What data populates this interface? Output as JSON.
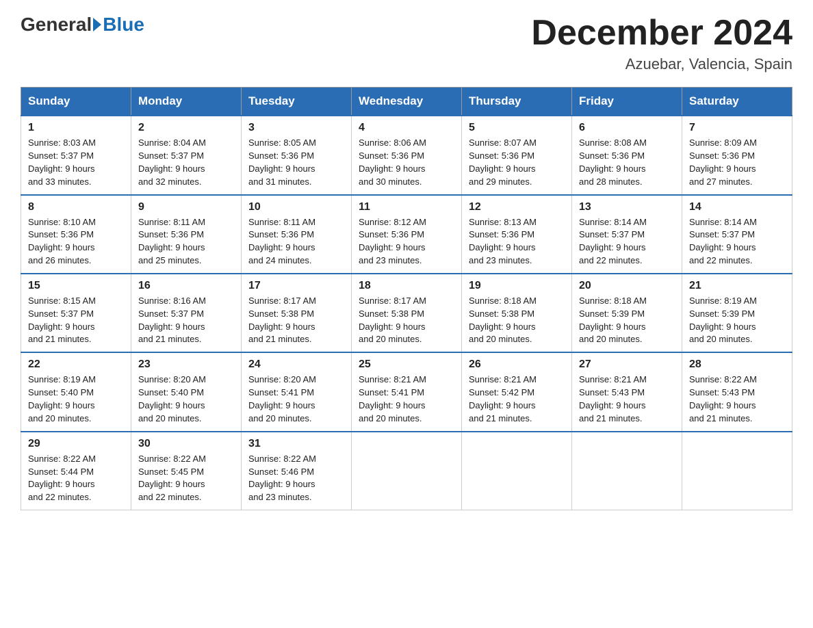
{
  "header": {
    "logo": {
      "general": "General",
      "blue": "Blue"
    },
    "title": "December 2024",
    "location": "Azuebar, Valencia, Spain"
  },
  "days_of_week": [
    "Sunday",
    "Monday",
    "Tuesday",
    "Wednesday",
    "Thursday",
    "Friday",
    "Saturday"
  ],
  "weeks": [
    [
      {
        "day": "1",
        "sunrise": "8:03 AM",
        "sunset": "5:37 PM",
        "daylight": "9 hours and 33 minutes."
      },
      {
        "day": "2",
        "sunrise": "8:04 AM",
        "sunset": "5:37 PM",
        "daylight": "9 hours and 32 minutes."
      },
      {
        "day": "3",
        "sunrise": "8:05 AM",
        "sunset": "5:36 PM",
        "daylight": "9 hours and 31 minutes."
      },
      {
        "day": "4",
        "sunrise": "8:06 AM",
        "sunset": "5:36 PM",
        "daylight": "9 hours and 30 minutes."
      },
      {
        "day": "5",
        "sunrise": "8:07 AM",
        "sunset": "5:36 PM",
        "daylight": "9 hours and 29 minutes."
      },
      {
        "day": "6",
        "sunrise": "8:08 AM",
        "sunset": "5:36 PM",
        "daylight": "9 hours and 28 minutes."
      },
      {
        "day": "7",
        "sunrise": "8:09 AM",
        "sunset": "5:36 PM",
        "daylight": "9 hours and 27 minutes."
      }
    ],
    [
      {
        "day": "8",
        "sunrise": "8:10 AM",
        "sunset": "5:36 PM",
        "daylight": "9 hours and 26 minutes."
      },
      {
        "day": "9",
        "sunrise": "8:11 AM",
        "sunset": "5:36 PM",
        "daylight": "9 hours and 25 minutes."
      },
      {
        "day": "10",
        "sunrise": "8:11 AM",
        "sunset": "5:36 PM",
        "daylight": "9 hours and 24 minutes."
      },
      {
        "day": "11",
        "sunrise": "8:12 AM",
        "sunset": "5:36 PM",
        "daylight": "9 hours and 23 minutes."
      },
      {
        "day": "12",
        "sunrise": "8:13 AM",
        "sunset": "5:36 PM",
        "daylight": "9 hours and 23 minutes."
      },
      {
        "day": "13",
        "sunrise": "8:14 AM",
        "sunset": "5:37 PM",
        "daylight": "9 hours and 22 minutes."
      },
      {
        "day": "14",
        "sunrise": "8:14 AM",
        "sunset": "5:37 PM",
        "daylight": "9 hours and 22 minutes."
      }
    ],
    [
      {
        "day": "15",
        "sunrise": "8:15 AM",
        "sunset": "5:37 PM",
        "daylight": "9 hours and 21 minutes."
      },
      {
        "day": "16",
        "sunrise": "8:16 AM",
        "sunset": "5:37 PM",
        "daylight": "9 hours and 21 minutes."
      },
      {
        "day": "17",
        "sunrise": "8:17 AM",
        "sunset": "5:38 PM",
        "daylight": "9 hours and 21 minutes."
      },
      {
        "day": "18",
        "sunrise": "8:17 AM",
        "sunset": "5:38 PM",
        "daylight": "9 hours and 20 minutes."
      },
      {
        "day": "19",
        "sunrise": "8:18 AM",
        "sunset": "5:38 PM",
        "daylight": "9 hours and 20 minutes."
      },
      {
        "day": "20",
        "sunrise": "8:18 AM",
        "sunset": "5:39 PM",
        "daylight": "9 hours and 20 minutes."
      },
      {
        "day": "21",
        "sunrise": "8:19 AM",
        "sunset": "5:39 PM",
        "daylight": "9 hours and 20 minutes."
      }
    ],
    [
      {
        "day": "22",
        "sunrise": "8:19 AM",
        "sunset": "5:40 PM",
        "daylight": "9 hours and 20 minutes."
      },
      {
        "day": "23",
        "sunrise": "8:20 AM",
        "sunset": "5:40 PM",
        "daylight": "9 hours and 20 minutes."
      },
      {
        "day": "24",
        "sunrise": "8:20 AM",
        "sunset": "5:41 PM",
        "daylight": "9 hours and 20 minutes."
      },
      {
        "day": "25",
        "sunrise": "8:21 AM",
        "sunset": "5:41 PM",
        "daylight": "9 hours and 20 minutes."
      },
      {
        "day": "26",
        "sunrise": "8:21 AM",
        "sunset": "5:42 PM",
        "daylight": "9 hours and 21 minutes."
      },
      {
        "day": "27",
        "sunrise": "8:21 AM",
        "sunset": "5:43 PM",
        "daylight": "9 hours and 21 minutes."
      },
      {
        "day": "28",
        "sunrise": "8:22 AM",
        "sunset": "5:43 PM",
        "daylight": "9 hours and 21 minutes."
      }
    ],
    [
      {
        "day": "29",
        "sunrise": "8:22 AM",
        "sunset": "5:44 PM",
        "daylight": "9 hours and 22 minutes."
      },
      {
        "day": "30",
        "sunrise": "8:22 AM",
        "sunset": "5:45 PM",
        "daylight": "9 hours and 22 minutes."
      },
      {
        "day": "31",
        "sunrise": "8:22 AM",
        "sunset": "5:46 PM",
        "daylight": "9 hours and 23 minutes."
      },
      null,
      null,
      null,
      null
    ]
  ],
  "labels": {
    "sunrise": "Sunrise:",
    "sunset": "Sunset:",
    "daylight": "Daylight:"
  }
}
